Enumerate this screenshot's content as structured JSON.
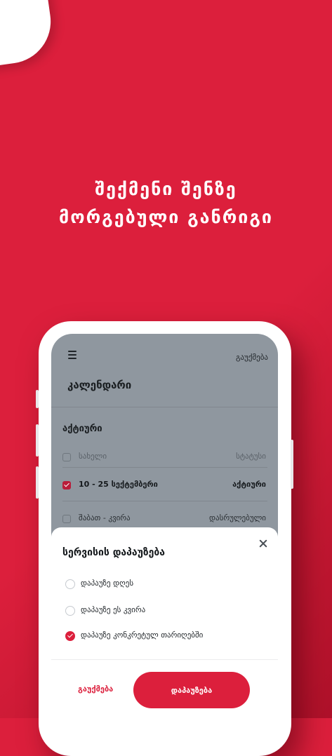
{
  "headline": {
    "line1": "შექმენი შენზე",
    "line2": "მორგებული განრიგი"
  },
  "app": {
    "menu_icon": "hamburger-menu-icon",
    "cancel_label": "გაუქმება",
    "title": "კალენდარი",
    "section_title": "აქტიური",
    "table": {
      "header": {
        "name": "სახელი",
        "status": "სტატუსი"
      },
      "rows": [
        {
          "name": "10 - 25 სექტემბერი",
          "status": "აქტიური",
          "checked": true
        },
        {
          "name": "შაბათ - კვირა",
          "status": "დასრულებული",
          "checked": false
        }
      ]
    }
  },
  "sheet": {
    "title": "სერვისის დაპაუზება",
    "close_icon": "close-icon",
    "options": [
      {
        "label": "დაპაუზე დღეს",
        "selected": false
      },
      {
        "label": "დაპაუზე ეს კვირა",
        "selected": false
      },
      {
        "label": "დაპაუზე კონკრეტულ თარიღებში",
        "selected": true
      }
    ],
    "cancel_label": "გაუქმება",
    "confirm_label": "დაპაუზება"
  },
  "colors": {
    "brand_red": "#dc1f3c",
    "overlay_gray": "#8f979f"
  }
}
